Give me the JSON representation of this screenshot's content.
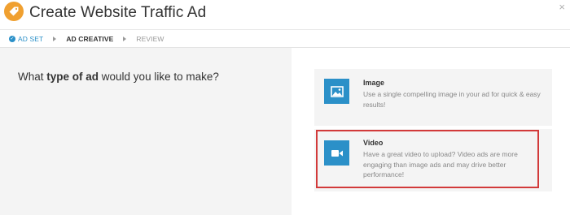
{
  "header": {
    "title": "Create Website Traffic Ad",
    "close_label": "×",
    "logo_icon": "tag-icon",
    "logo_color": "#f0a030"
  },
  "steps": [
    {
      "label": "AD SET",
      "state": "done"
    },
    {
      "label": "AD CREATIVE",
      "state": "active"
    },
    {
      "label": "REVIEW",
      "state": "next"
    }
  ],
  "question": {
    "prefix": "What ",
    "emphasis": "type of ad",
    "suffix": " would you like to make?"
  },
  "options": [
    {
      "title": "Image",
      "description": "Use a single compelling image in your ad for quick & easy results!",
      "icon": "image-icon"
    },
    {
      "title": "Video",
      "description": "Have a great video to upload? Video ads are more engaging than image ads and may drive better performance!",
      "icon": "video-camera-icon"
    }
  ],
  "colors": {
    "accent": "#2b90c8",
    "highlight": "#d23a3a"
  }
}
